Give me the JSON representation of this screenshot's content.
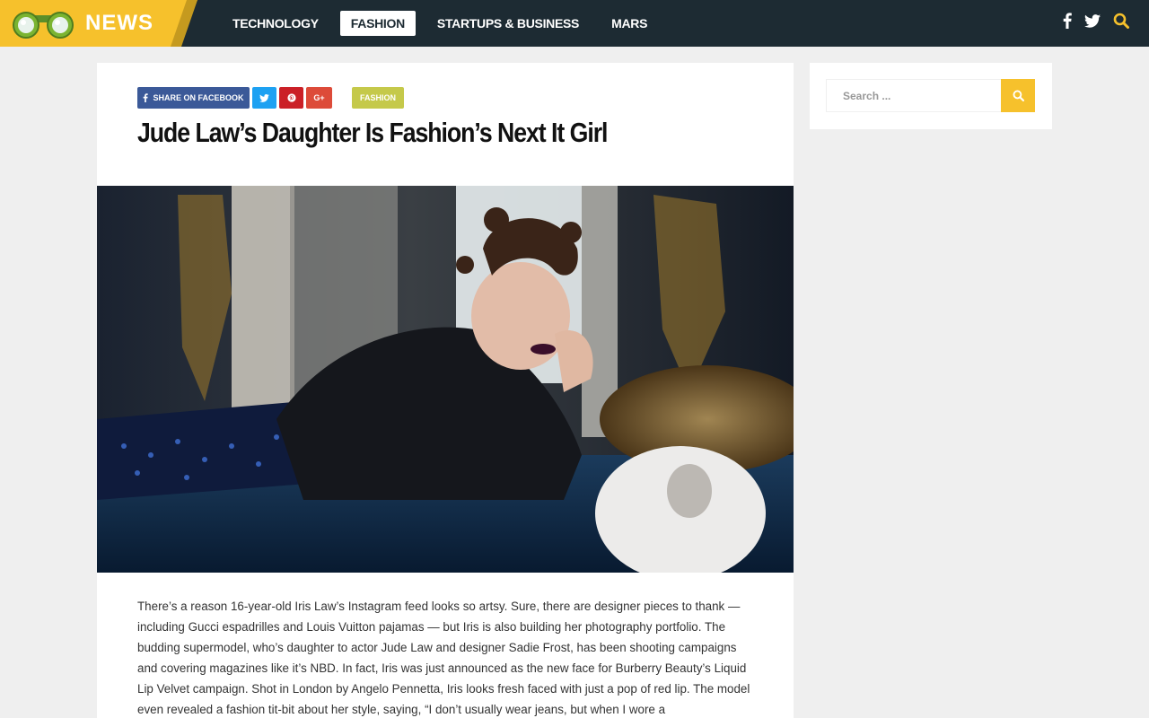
{
  "header": {
    "logo_text": "NEWS",
    "nav": [
      {
        "label": "TECHNOLOGY",
        "active": false
      },
      {
        "label": "FASHION",
        "active": true
      },
      {
        "label": "STARTUPS & BUSINESS",
        "active": false
      },
      {
        "label": "MARS",
        "active": false
      }
    ],
    "icons": [
      "facebook-icon",
      "twitter-icon",
      "search-icon"
    ]
  },
  "article": {
    "share": {
      "facebook_label": "SHARE ON FACEBOOK",
      "google_label": "G+"
    },
    "category": "FASHION",
    "title": "Jude Law’s Daughter Is Fashion’s Next It Girl",
    "body": "There’s a reason 16-year-old Iris Law’s Instagram feed looks so artsy. Sure, there are designer pieces to thank — including Gucci espadrilles and Louis Vuitton pajamas — but Iris is also building her photography portfolio. The budding supermodel, who’s daughter to actor Jude Law and designer Sadie Frost, has been shooting campaigns and covering magazines like it’s NBD. In fact, Iris was just announced as the new face for Burberry Beauty’s Liquid Lip Velvet campaign. Shot in London by Angelo Pennetta, Iris looks fresh faced with just a pop of red lip. The model even revealed a fashion tit-bit about her style, saying, “I don’t usually wear jeans, but when I wore a"
  },
  "sidebar": {
    "search_placeholder": "Search ..."
  },
  "colors": {
    "header_bg": "#1d2b33",
    "brand_yellow": "#f6c12c",
    "category_tag": "#c5c94a"
  }
}
